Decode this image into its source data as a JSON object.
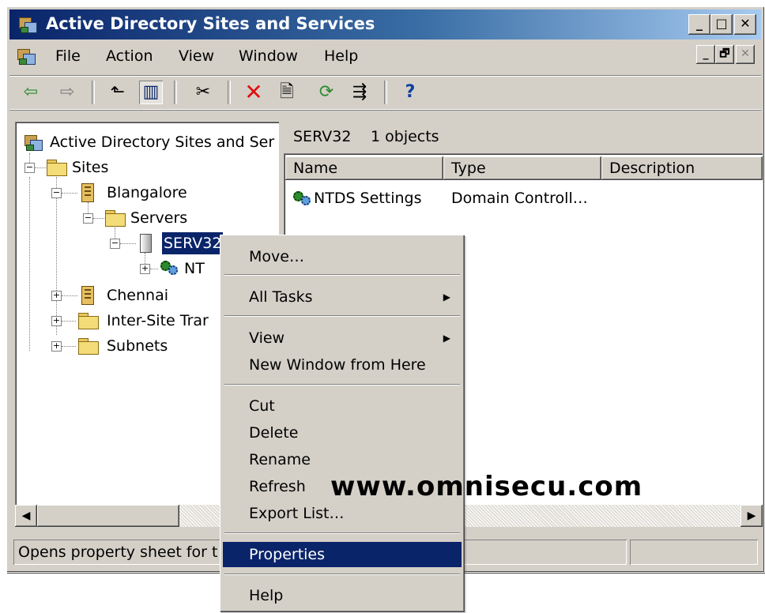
{
  "window": {
    "title": "Active Directory Sites and Services",
    "controls": {
      "minimize": "_",
      "maximize": "□",
      "close": "✕"
    }
  },
  "menubar": {
    "items": [
      {
        "label": "File"
      },
      {
        "label": "Action"
      },
      {
        "label": "View"
      },
      {
        "label": "Window"
      },
      {
        "label": "Help"
      }
    ],
    "mdi_controls": {
      "minimize": "_",
      "restore": "🗗",
      "close": "✕"
    }
  },
  "toolbar": {
    "icons": [
      "back-arrow-icon",
      "forward-arrow-icon",
      "up-one-level-icon",
      "show-hide-console-tree-icon",
      "cut-icon",
      "delete-icon",
      "properties-icon",
      "refresh-icon",
      "export-list-icon",
      "help-icon"
    ],
    "glyphs": {
      "back": "⇦",
      "forward": "⇨",
      "up": "⬑",
      "tree": "▥",
      "cut": "✂",
      "delete": "✕",
      "properties": "🗎",
      "refresh": "⟳",
      "export": "⇶",
      "help": "?"
    }
  },
  "tree": {
    "root": "Active Directory Sites and Ser",
    "nodes": [
      {
        "label": "Sites",
        "expander": "−"
      },
      {
        "label": "Blangalore",
        "expander": "−"
      },
      {
        "label": "Servers",
        "expander": "−"
      },
      {
        "label": "SERV32",
        "expander": "−"
      },
      {
        "label": "NT",
        "expander": "+"
      },
      {
        "label": "Chennai",
        "expander": "+"
      },
      {
        "label": "Inter-Site Trar",
        "expander": "+"
      },
      {
        "label": "Subnets",
        "expander": "+"
      }
    ]
  },
  "details": {
    "header_name": "SERV32",
    "header_count": "1 objects",
    "columns": [
      "Name",
      "Type",
      "Description"
    ],
    "rows": [
      {
        "name": "NTDS Settings",
        "type": "Domain Controll…",
        "description": ""
      }
    ]
  },
  "context_menu": {
    "items": [
      {
        "label": "Move…",
        "submenu": false
      },
      {
        "label": "All Tasks",
        "submenu": true
      },
      {
        "label": "View",
        "submenu": true
      },
      {
        "label": "New Window from Here",
        "submenu": false
      },
      {
        "label": "Cut",
        "submenu": false
      },
      {
        "label": "Delete",
        "submenu": false
      },
      {
        "label": "Rename",
        "submenu": false
      },
      {
        "label": "Refresh",
        "submenu": false
      },
      {
        "label": "Export List…",
        "submenu": false
      },
      {
        "label": "Properties",
        "submenu": false,
        "highlighted": true
      },
      {
        "label": "Help",
        "submenu": false
      }
    ],
    "submenu_arrow": "▶"
  },
  "scrollbar": {
    "left_arrow": "◀",
    "right_arrow": "▶"
  },
  "statusbar": {
    "text": "Opens property sheet for t"
  },
  "watermark": "www.omnisecu.com",
  "colors": {
    "selection": "#0a246a",
    "chrome": "#d4d0c8",
    "titlebar_start": "#0a246a",
    "titlebar_end": "#a6caf0"
  }
}
